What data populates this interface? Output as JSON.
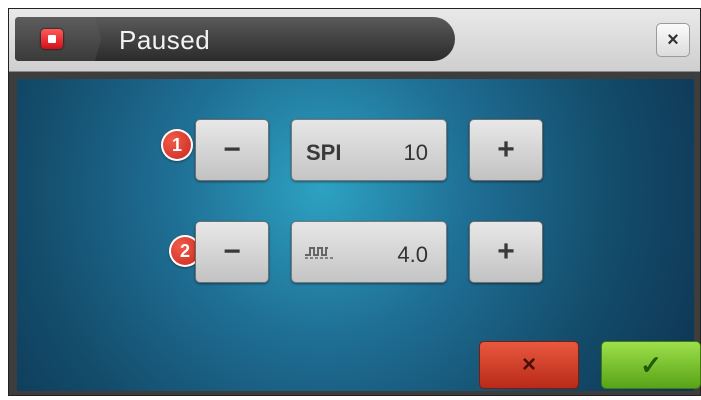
{
  "title_bar": {
    "title": "Paused",
    "stop_icon": "stop-icon",
    "close_label": "×"
  },
  "rows": [
    {
      "badge": "1",
      "minus_label": "−",
      "field_label": "SPI",
      "field_value": "10",
      "plus_label": "+"
    },
    {
      "badge": "2",
      "minus_label": "−",
      "field_icon": "stitch-length-icon",
      "field_value": "4.0",
      "plus_label": "+"
    }
  ],
  "actions": {
    "cancel_label": "×",
    "confirm_label": "✓"
  },
  "colors": {
    "panel_teal": "#1f6f95",
    "badge_red": "#d63a2b",
    "cancel_red": "#c93a22",
    "confirm_green": "#7cc335"
  }
}
